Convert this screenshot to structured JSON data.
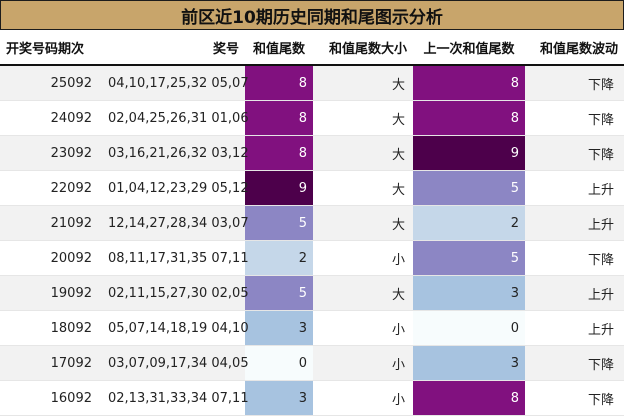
{
  "title": "前区近10期历史同期和尾图示分析",
  "headers": [
    "开奖号码期次",
    "奖号",
    "和值尾数",
    "和值尾数大小",
    "上一次和值尾数",
    "和值尾数波动"
  ],
  "rows": [
    {
      "issue": "25092",
      "numbers": "04,10,17,25,32 05,07",
      "tail": "8",
      "size": "大",
      "prev": "8",
      "trend": "下降"
    },
    {
      "issue": "24092",
      "numbers": "02,04,25,26,31 01,06",
      "tail": "8",
      "size": "大",
      "prev": "8",
      "trend": "下降"
    },
    {
      "issue": "23092",
      "numbers": "03,16,21,26,32 03,12",
      "tail": "8",
      "size": "大",
      "prev": "9",
      "trend": "下降"
    },
    {
      "issue": "22092",
      "numbers": "01,04,12,23,29 05,12",
      "tail": "9",
      "size": "大",
      "prev": "5",
      "trend": "上升"
    },
    {
      "issue": "21092",
      "numbers": "12,14,27,28,34 03,07",
      "tail": "5",
      "size": "大",
      "prev": "2",
      "trend": "上升"
    },
    {
      "issue": "20092",
      "numbers": "08,11,17,31,35 07,11",
      "tail": "2",
      "size": "小",
      "prev": "5",
      "trend": "下降"
    },
    {
      "issue": "19092",
      "numbers": "02,11,15,27,30 02,05",
      "tail": "5",
      "size": "大",
      "prev": "3",
      "trend": "上升"
    },
    {
      "issue": "18092",
      "numbers": "05,07,14,18,19 04,10",
      "tail": "3",
      "size": "小",
      "prev": "0",
      "trend": "上升"
    },
    {
      "issue": "17092",
      "numbers": "03,07,09,17,34 04,05",
      "tail": "0",
      "size": "小",
      "prev": "3",
      "trend": "下降"
    },
    {
      "issue": "16092",
      "numbers": "02,13,31,33,34 07,11",
      "tail": "3",
      "size": "小",
      "prev": "8",
      "trend": "下降"
    }
  ],
  "heat_colors": {
    "0": "#f7fcfd",
    "2": "#c5d7e9",
    "3": "#a7c3e0",
    "5": "#8c86c4",
    "8": "#81117f",
    "9": "#4d004b"
  }
}
